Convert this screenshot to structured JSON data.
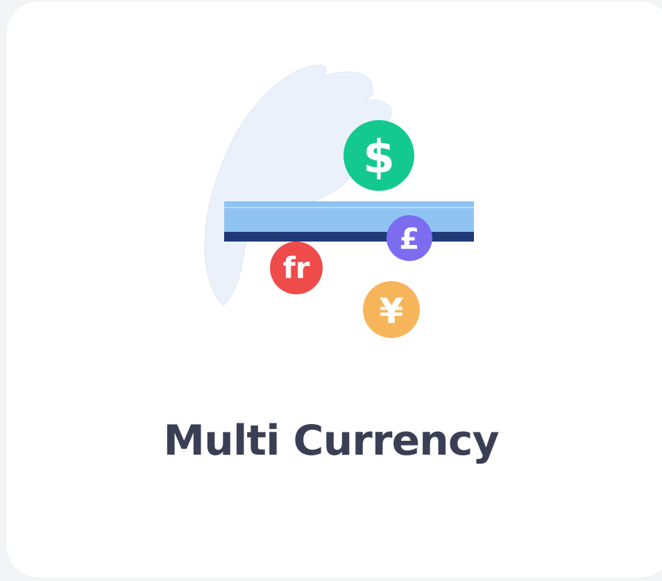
{
  "card": {
    "title": "Multi Currency"
  },
  "illustration": {
    "coins": [
      {
        "name": "dollar-coin",
        "symbol": "$",
        "color": "#14c98e"
      },
      {
        "name": "pound-coin",
        "symbol": "£",
        "color": "#7b6cf0"
      },
      {
        "name": "franc-coin",
        "symbol": "fr",
        "color": "#ef4b4b"
      },
      {
        "name": "yen-coin",
        "symbol": "¥",
        "color": "#f7b55a"
      }
    ],
    "hand_color": "#ebf1fa",
    "card_light_color": "#8fc4f2",
    "card_dark_color": "#1f3a77"
  }
}
